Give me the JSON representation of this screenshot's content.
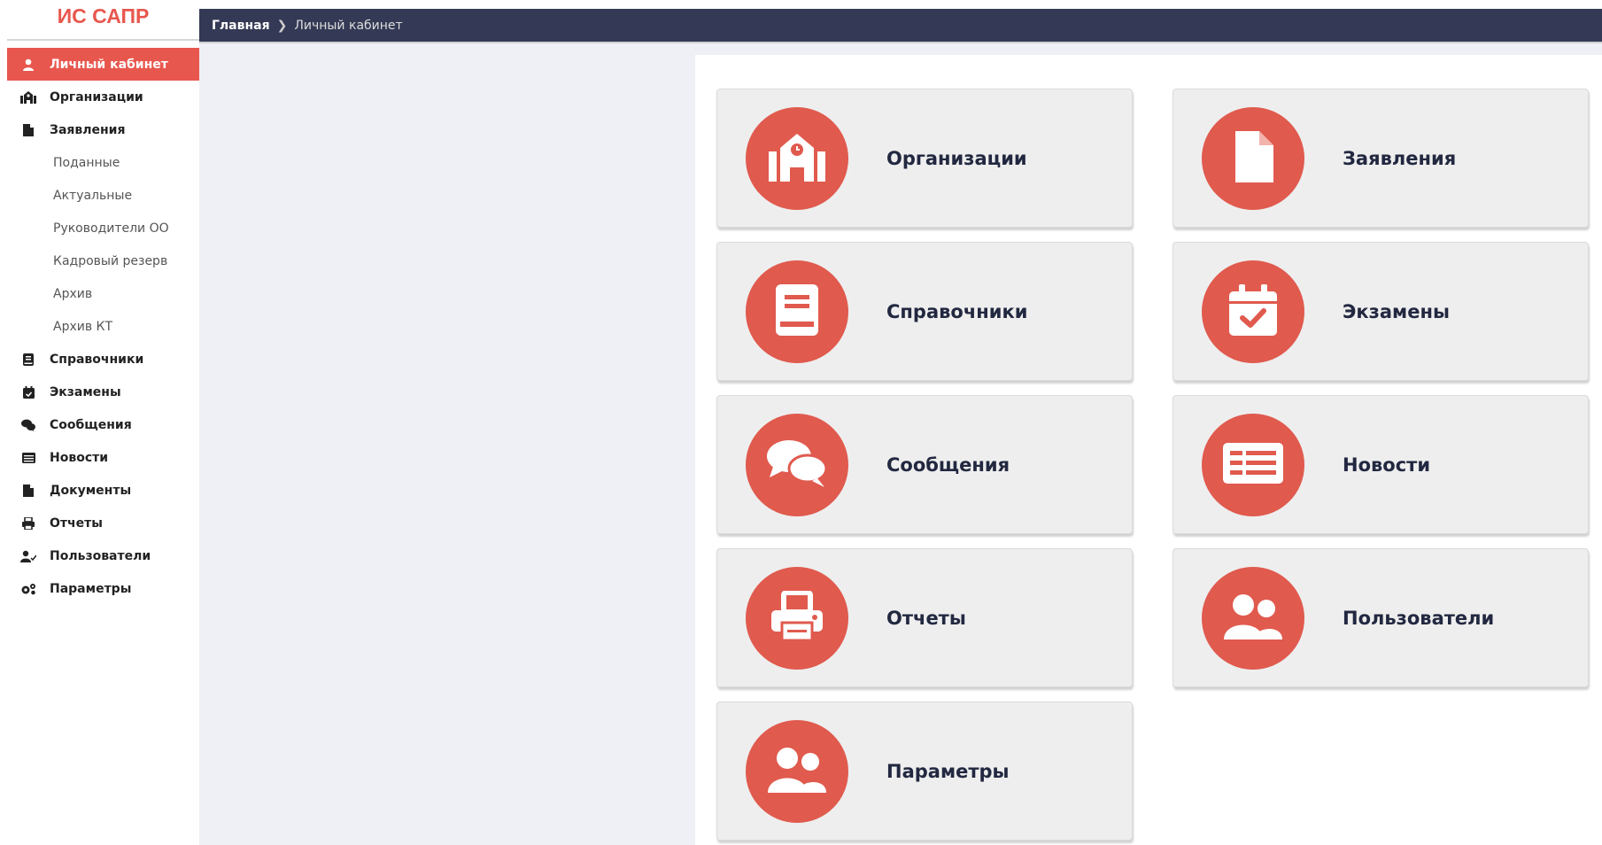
{
  "app": {
    "title": "ИС САПР"
  },
  "breadcrumb": {
    "home": "Главная",
    "separator": "❯",
    "current": "Личный кабинет"
  },
  "sidebar": {
    "items": [
      {
        "label": "Личный кабинет",
        "icon": "user-icon",
        "active": true
      },
      {
        "label": "Организации",
        "icon": "school-icon"
      },
      {
        "label": "Заявления",
        "icon": "file-icon"
      },
      {
        "label": "Поданные",
        "sub": true
      },
      {
        "label": "Актуальные",
        "sub": true
      },
      {
        "label": "Руководители ОО",
        "sub": true
      },
      {
        "label": "Кадровый резерв",
        "sub": true
      },
      {
        "label": "Архив",
        "sub": true
      },
      {
        "label": "Архив КТ",
        "sub": true
      },
      {
        "label": "Справочники",
        "icon": "book-icon"
      },
      {
        "label": "Экзамены",
        "icon": "calendar-check-icon"
      },
      {
        "label": "Сообщения",
        "icon": "comments-icon"
      },
      {
        "label": "Новости",
        "icon": "newspaper-icon"
      },
      {
        "label": "Документы",
        "icon": "file-icon"
      },
      {
        "label": "Отчеты",
        "icon": "print-icon"
      },
      {
        "label": "Пользователи",
        "icon": "users-icon"
      },
      {
        "label": "Параметры",
        "icon": "cogs-icon"
      }
    ]
  },
  "tiles": [
    {
      "label": "Организации",
      "icon": "school-icon"
    },
    {
      "label": "Заявления",
      "icon": "file-icon"
    },
    {
      "label": "Справочники",
      "icon": "book-icon"
    },
    {
      "label": "Экзамены",
      "icon": "calendar-check-icon"
    },
    {
      "label": "Сообщения",
      "icon": "comments-icon"
    },
    {
      "label": "Новости",
      "icon": "newspaper-icon"
    },
    {
      "label": "Отчеты",
      "icon": "print-icon"
    },
    {
      "label": "Пользователи",
      "icon": "users-icon"
    },
    {
      "label": "Параметры",
      "icon": "users-icon"
    }
  ],
  "colors": {
    "accent": "#e05a4e",
    "topbar": "#343a55",
    "sidebar_active": "#e8574e"
  }
}
